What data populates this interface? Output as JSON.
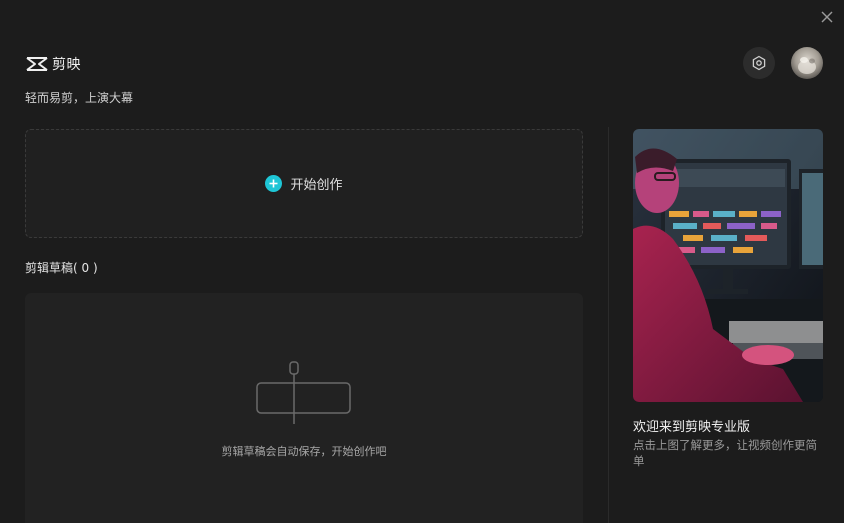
{
  "app": {
    "logo_text": "剪映",
    "tagline": "轻而易剪，上演大幕"
  },
  "header": {
    "settings_icon": "settings-hexagon-icon",
    "close_icon": "close-icon"
  },
  "create": {
    "label": "开始创作",
    "accent": "#1ec6d6"
  },
  "drafts": {
    "title": "剪辑草稿( 0 )",
    "empty_text": "剪辑草稿会自动保存，开始创作吧"
  },
  "promo": {
    "title": "欢迎来到剪映专业版",
    "description": "点击上图了解更多，让视频创作更简单"
  }
}
